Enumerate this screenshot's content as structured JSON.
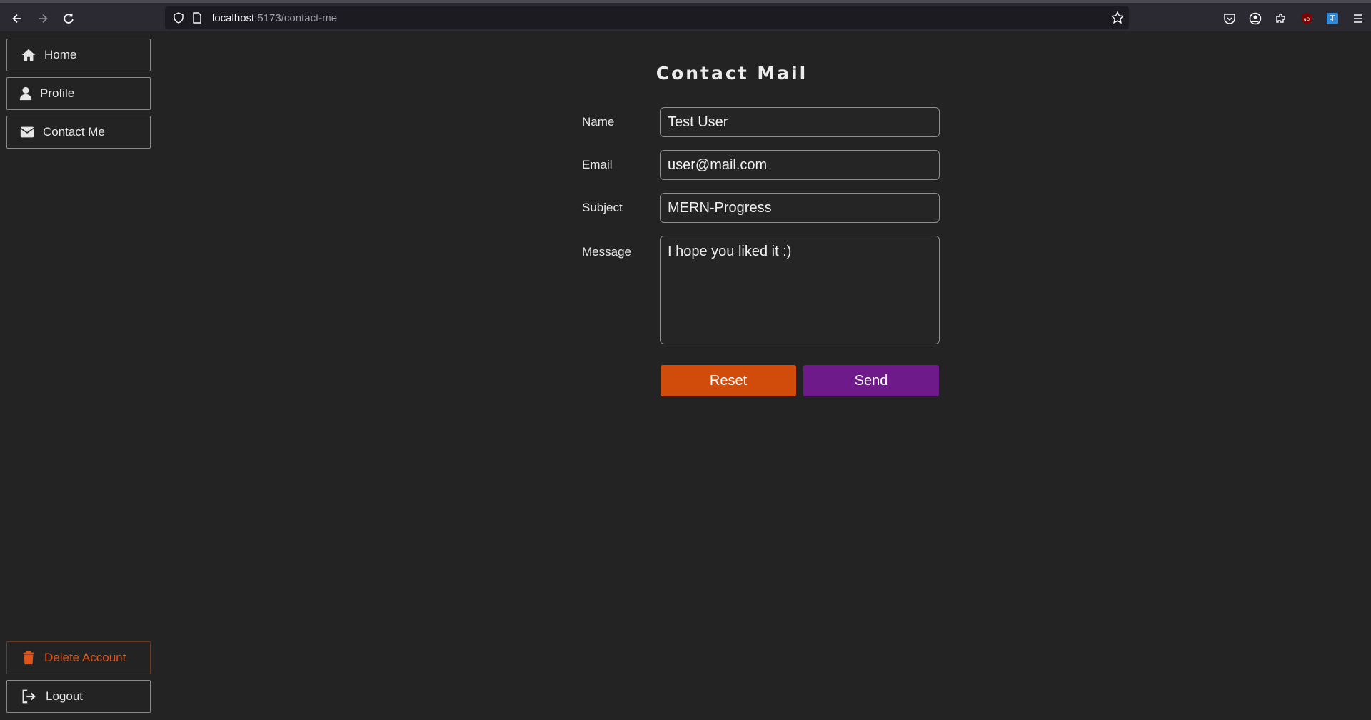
{
  "browser": {
    "url_host": "localhost",
    "url_rest": ":5173/contact-me",
    "icons": [
      "back-icon",
      "forward-icon",
      "reload-icon",
      "shield-icon",
      "page-icon",
      "star-icon",
      "pocket-icon",
      "account-icon",
      "extensions-icon",
      "ublock-icon",
      "translate-icon",
      "menu-icon"
    ]
  },
  "sidebar": {
    "items": [
      {
        "label": "Home",
        "icon": "home-icon"
      },
      {
        "label": "Profile",
        "icon": "user-icon"
      },
      {
        "label": "Contact Me",
        "icon": "envelope-icon"
      }
    ],
    "bottom_items": [
      {
        "label": "Delete Account",
        "icon": "trash-icon",
        "color": "#e0541c"
      },
      {
        "label": "Logout",
        "icon": "logout-icon"
      }
    ]
  },
  "main": {
    "title": "Contact Mail",
    "fields": {
      "name": {
        "label": "Name",
        "value": "Test User"
      },
      "email": {
        "label": "Email",
        "value": "user@mail.com"
      },
      "subject": {
        "label": "Subject",
        "value": "MERN-Progress"
      },
      "message": {
        "label": "Message",
        "value": "I hope you liked it :)"
      }
    },
    "buttons": {
      "reset": {
        "label": "Reset",
        "color": "#d14b0a"
      },
      "send": {
        "label": "Send",
        "color": "#6e1a8a"
      }
    }
  }
}
